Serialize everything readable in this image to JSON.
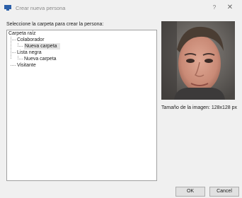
{
  "window": {
    "title": "Crear nueva persona",
    "help_glyph": "?",
    "close_glyph": "✕"
  },
  "prompt": "Seleccione la carpeta para crear la persona:",
  "tree": {
    "root": "Carpeta raíz",
    "items": [
      {
        "label": "Colaborador"
      },
      {
        "label": "Nueva carpeta",
        "selected": true
      },
      {
        "label": "Lista negra"
      },
      {
        "label": "Nueva carpeta"
      },
      {
        "label": "Visitante"
      }
    ]
  },
  "image_size_label": "Tamaño de la imagen: 128x128 px",
  "buttons": {
    "ok": "OK",
    "cancel": "Cancel"
  },
  "colors": {
    "accent": "#2b5fa8",
    "selection": "#e5e5e5",
    "border": "#a0a0a0"
  }
}
